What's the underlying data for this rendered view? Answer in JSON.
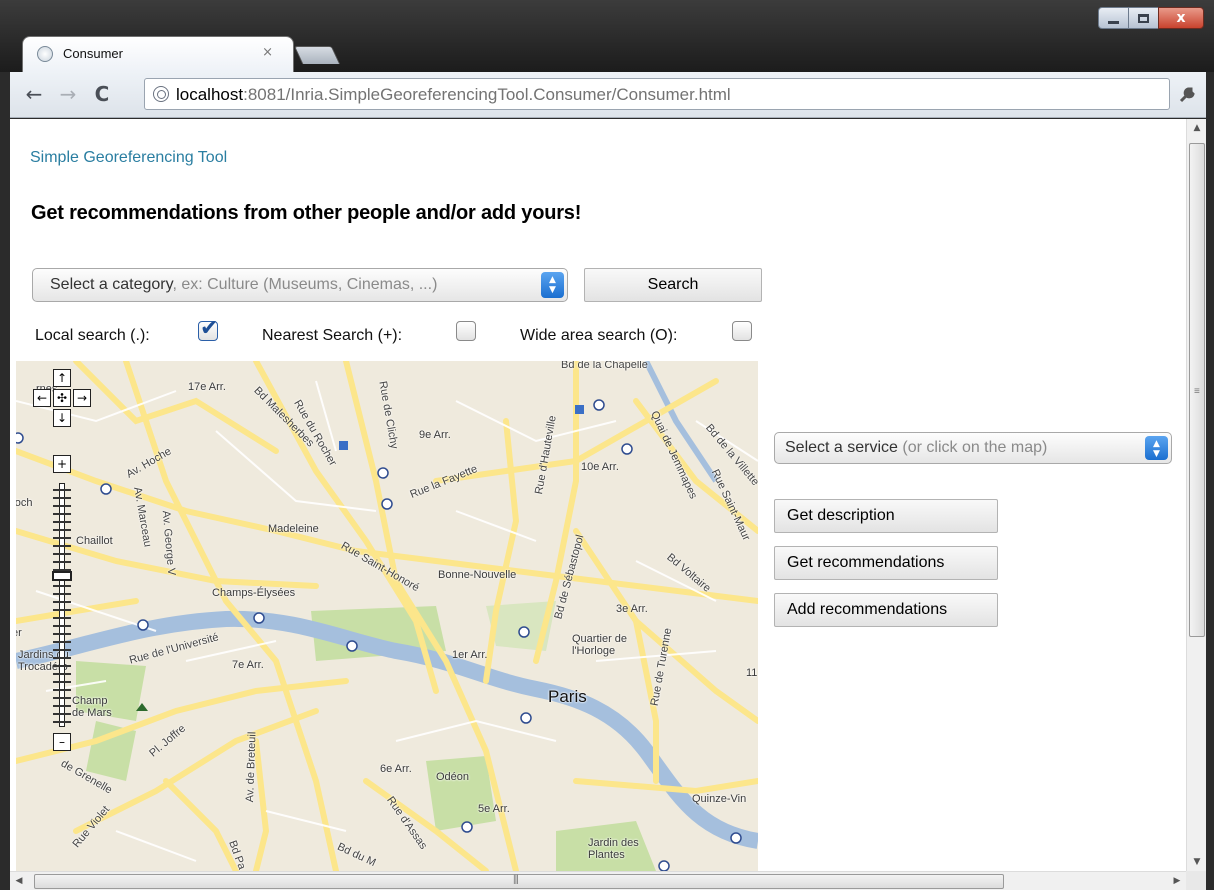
{
  "window": {
    "minimize_label": "minimize",
    "maximize_label": "maximize",
    "close_label": "x"
  },
  "tab": {
    "title": "Consumer",
    "close_glyph": "×"
  },
  "toolbar": {
    "back_glyph": "←",
    "forward_glyph": "→",
    "reload_glyph": "C",
    "url_host": "localhost",
    "url_rest": ":8081/Inria.SimpleGeoreferencingTool.Consumer/Consumer.html",
    "wrench_glyph": "🔧"
  },
  "page": {
    "brand": "Simple Georeferencing Tool",
    "headline": "Get recommendations from other people and/or add yours!",
    "category_select": {
      "label": "Select a category",
      "hint": ", ex: Culture (Museums, Cinemas, ...)"
    },
    "search_button": "Search",
    "options": [
      {
        "label": "Local search (.):",
        "checked": true
      },
      {
        "label": "Nearest Search (+):",
        "checked": false
      },
      {
        "label": "Wide area search (O):",
        "checked": false
      }
    ],
    "service_select": {
      "label": "Select a service",
      "hint": " (or click on the map)"
    },
    "actions": [
      "Get description",
      "Get recommendations",
      "Add recommendations"
    ]
  },
  "map": {
    "pan": {
      "up": "↑",
      "left": "←",
      "center": "✣",
      "right": "→",
      "down": "↓"
    },
    "zoom": {
      "in": "+",
      "out": "–"
    },
    "labels": [
      {
        "text": "Bd de la Chapelle"
      },
      {
        "text": "17e Arr."
      },
      {
        "text": "rnes"
      },
      {
        "text": "Bd Malesherbes"
      },
      {
        "text": "Rue du Rocher"
      },
      {
        "text": "Rue de Clichy"
      },
      {
        "text": "9e Arr."
      },
      {
        "text": "10e Arr."
      },
      {
        "text": "Rue la Fayette"
      },
      {
        "text": "Rue d'Hauteville"
      },
      {
        "text": "Quai de Jemmapes"
      },
      {
        "text": "Bd de la Villette"
      },
      {
        "text": "Av. Hoche"
      },
      {
        "text": "Foch"
      },
      {
        "text": "Chaillot"
      },
      {
        "text": "Av. Marceau"
      },
      {
        "text": "Av. George V"
      },
      {
        "text": "Madeleine"
      },
      {
        "text": "Rue Saint-Honoré"
      },
      {
        "text": "Bonne-Nouvelle"
      },
      {
        "text": "Bd de Sébastopol"
      },
      {
        "text": "Rue Saint-Maur"
      },
      {
        "text": "Bd Voltaire"
      },
      {
        "text": "Champs-Élysées"
      },
      {
        "text": "3e Arr."
      },
      {
        "text": "Rue de l'Université"
      },
      {
        "text": "Jardins du Trocadéro"
      },
      {
        "text": "7e Arr."
      },
      {
        "text": "1er Arr."
      },
      {
        "text": "Quartier de l'Horloge"
      },
      {
        "text": "11"
      },
      {
        "text": "Champ de Mars"
      },
      {
        "text": "Paris"
      },
      {
        "text": "Rue de Turenne"
      },
      {
        "text": "Pl. Joffre"
      },
      {
        "text": "Av. de Breteuil"
      },
      {
        "text": "6e Arr."
      },
      {
        "text": "Odéon"
      },
      {
        "text": "de Grenelle"
      },
      {
        "text": "5e Arr."
      },
      {
        "text": "Quinze-Vin"
      },
      {
        "text": "Rue Violet"
      },
      {
        "text": "Rue d'Assas"
      },
      {
        "text": "Bd Pa"
      },
      {
        "text": "Bd du M"
      },
      {
        "text": "Jardin des Plantes"
      },
      {
        "text": "er"
      }
    ]
  },
  "colors": {
    "brand": "#2a7ea1",
    "road": "#fce68b",
    "river": "#a5bfdd",
    "park": "#c8dfa6",
    "map_bg": "#efeadd"
  }
}
